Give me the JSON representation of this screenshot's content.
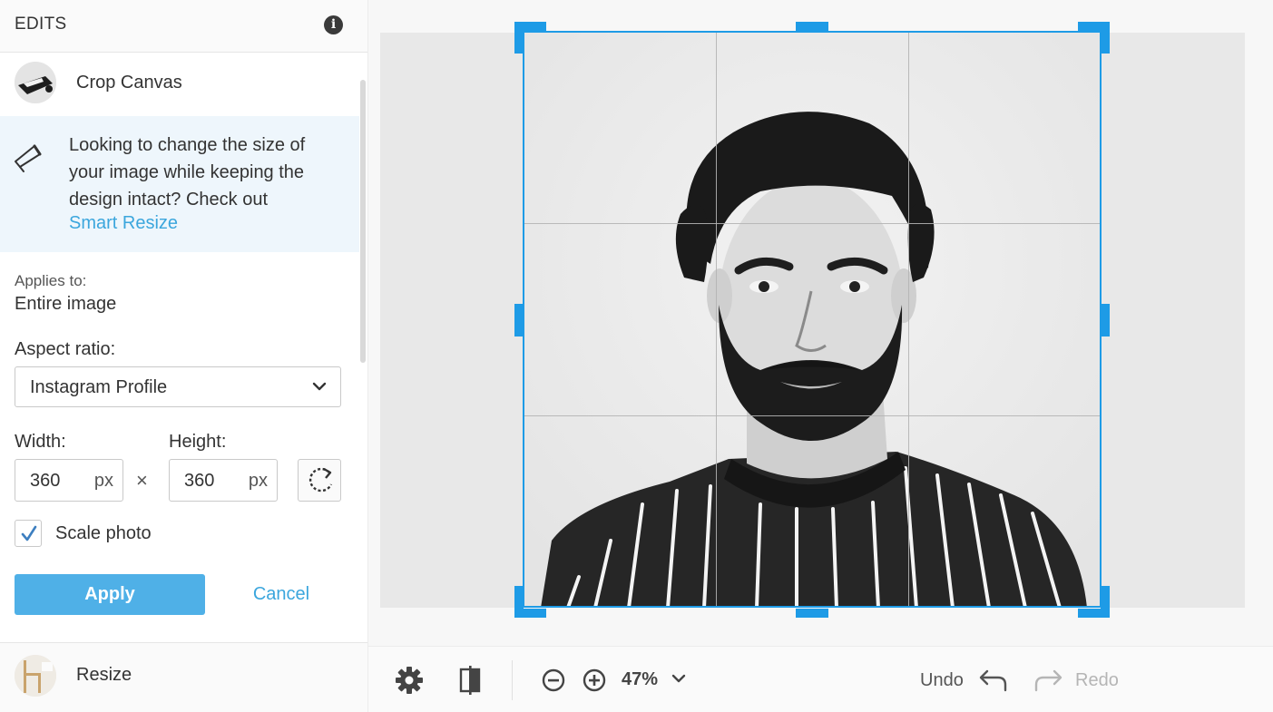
{
  "sidebar": {
    "title": "EDITS",
    "crop_tool_label": "Crop Canvas",
    "tip": {
      "text": "Looking to change the size of your image while keeping the design intact? Check out",
      "link": "Smart Resize"
    },
    "applies_to_label": "Applies to:",
    "applies_to_value": "Entire image",
    "aspect_label": "Aspect ratio:",
    "aspect_value": "Instagram Profile",
    "width_label": "Width:",
    "height_label": "Height:",
    "width_value": "360",
    "height_value": "360",
    "unit": "px",
    "times_symbol": "×",
    "scale_photo_label": "Scale photo",
    "scale_photo_checked": true,
    "apply_label": "Apply",
    "cancel_label": "Cancel",
    "resize_tool_label": "Resize"
  },
  "toolbar": {
    "zoom_value": "47%",
    "undo_label": "Undo",
    "redo_label": "Redo"
  },
  "icons": {
    "info": "info-icon",
    "megaphone": "megaphone-icon",
    "chevron": "chevron-down-icon",
    "rotate": "rotate-icon",
    "check": "check-icon",
    "settings": "gear-icon",
    "compare": "compare-icon",
    "zoom_out": "zoom-out-icon",
    "zoom_in": "zoom-in-icon",
    "undo": "undo-icon",
    "redo": "redo-icon"
  },
  "colors": {
    "accent": "#4fb0e7",
    "link": "#3ba6dd",
    "crop_frame": "#1e9be6",
    "tip_bg": "#eef6fc"
  }
}
